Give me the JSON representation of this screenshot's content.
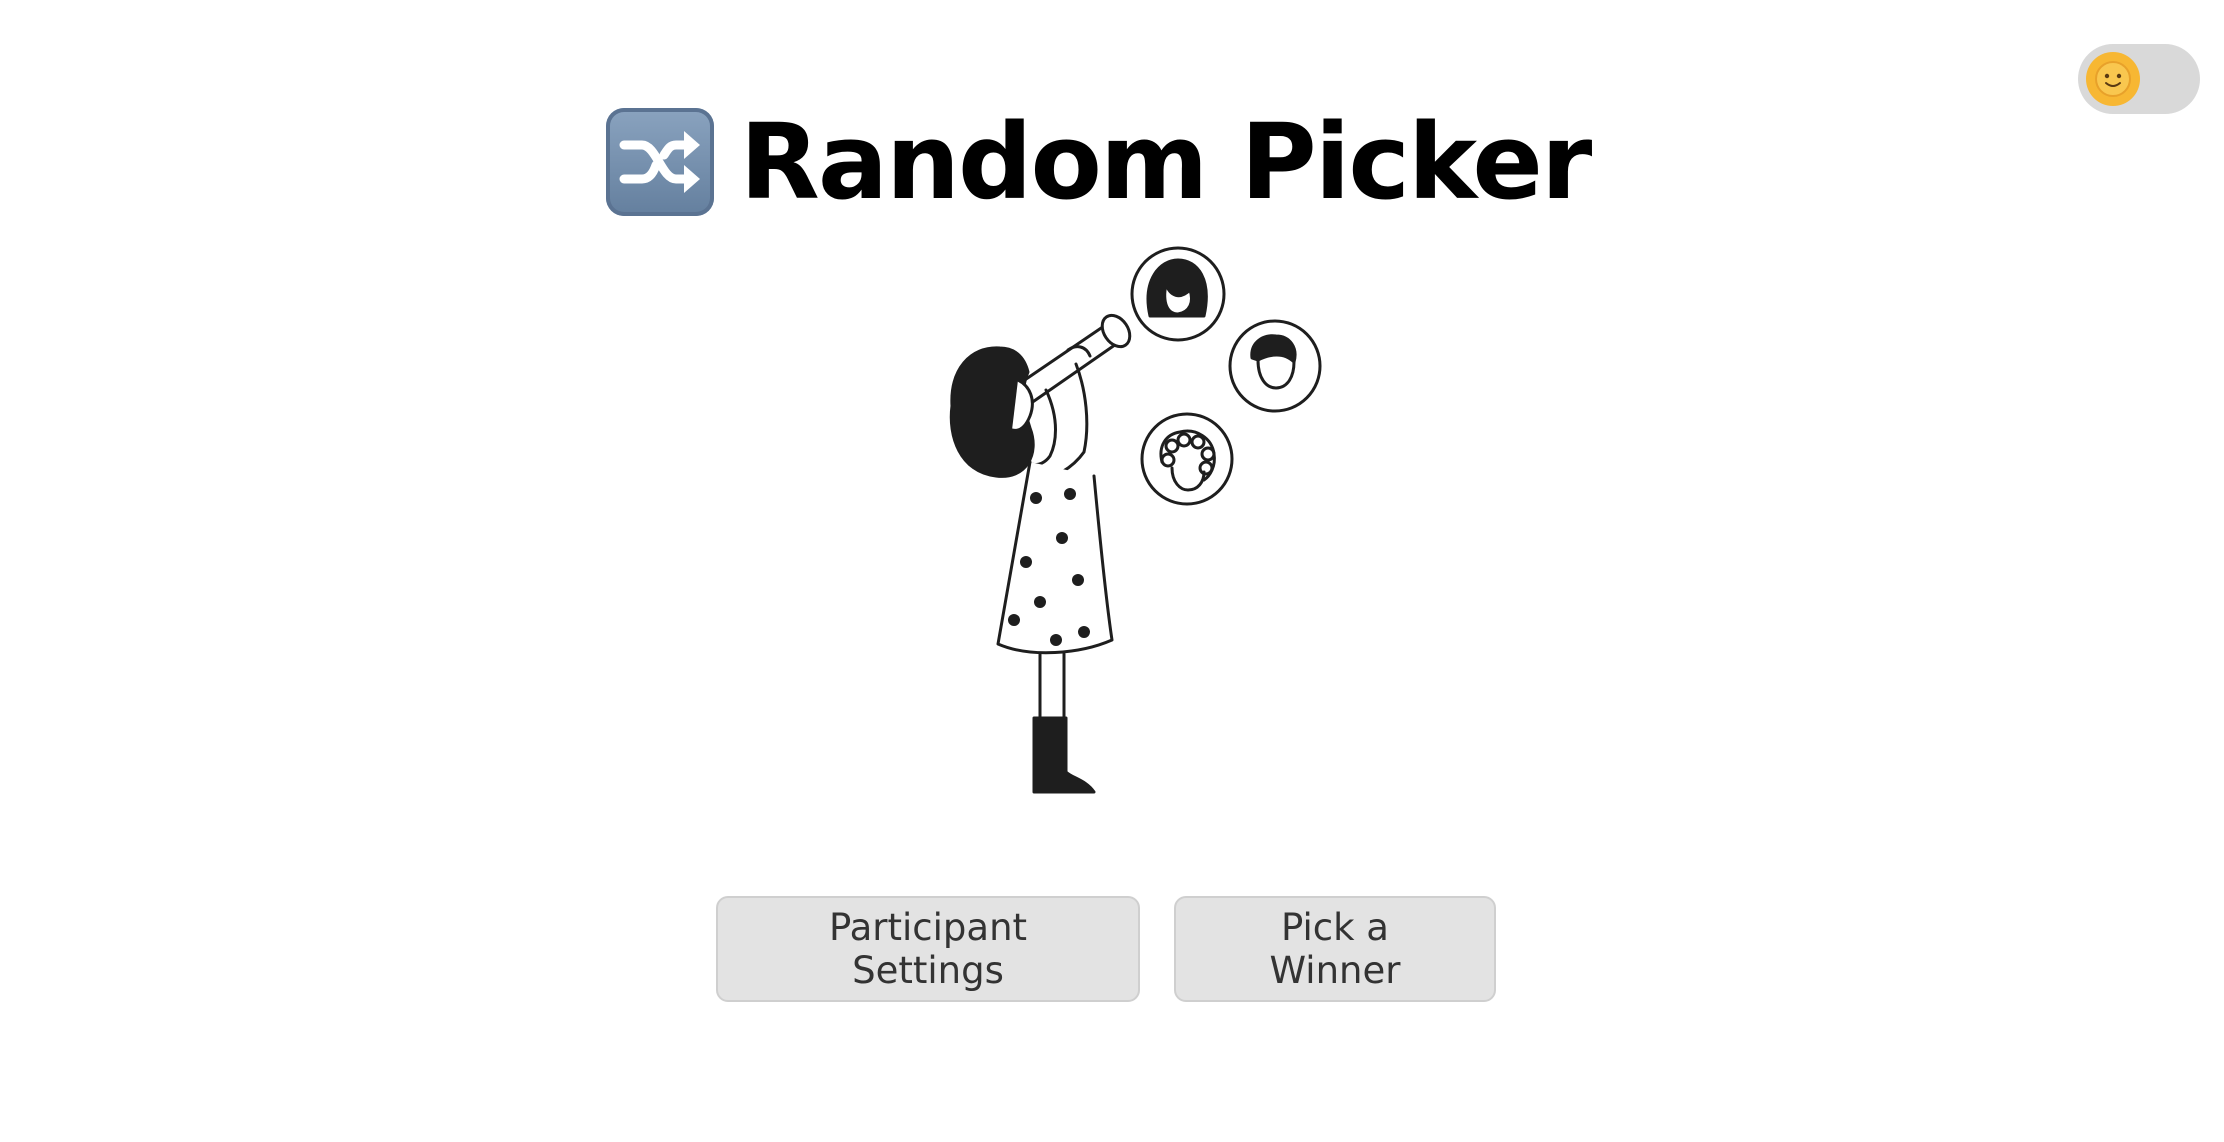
{
  "header": {
    "title": "Random Picker",
    "icon": "shuffle-icon",
    "icon_color": "#6f89a8"
  },
  "theme_toggle": {
    "state": "light",
    "knob_icon": "sun-face-icon",
    "knob_color": "#f7b733"
  },
  "illustration": {
    "icon": "woman-with-telescope-illustration"
  },
  "buttons": {
    "participant_settings_label": "Participant Settings",
    "pick_winner_label": "Pick a Winner"
  }
}
